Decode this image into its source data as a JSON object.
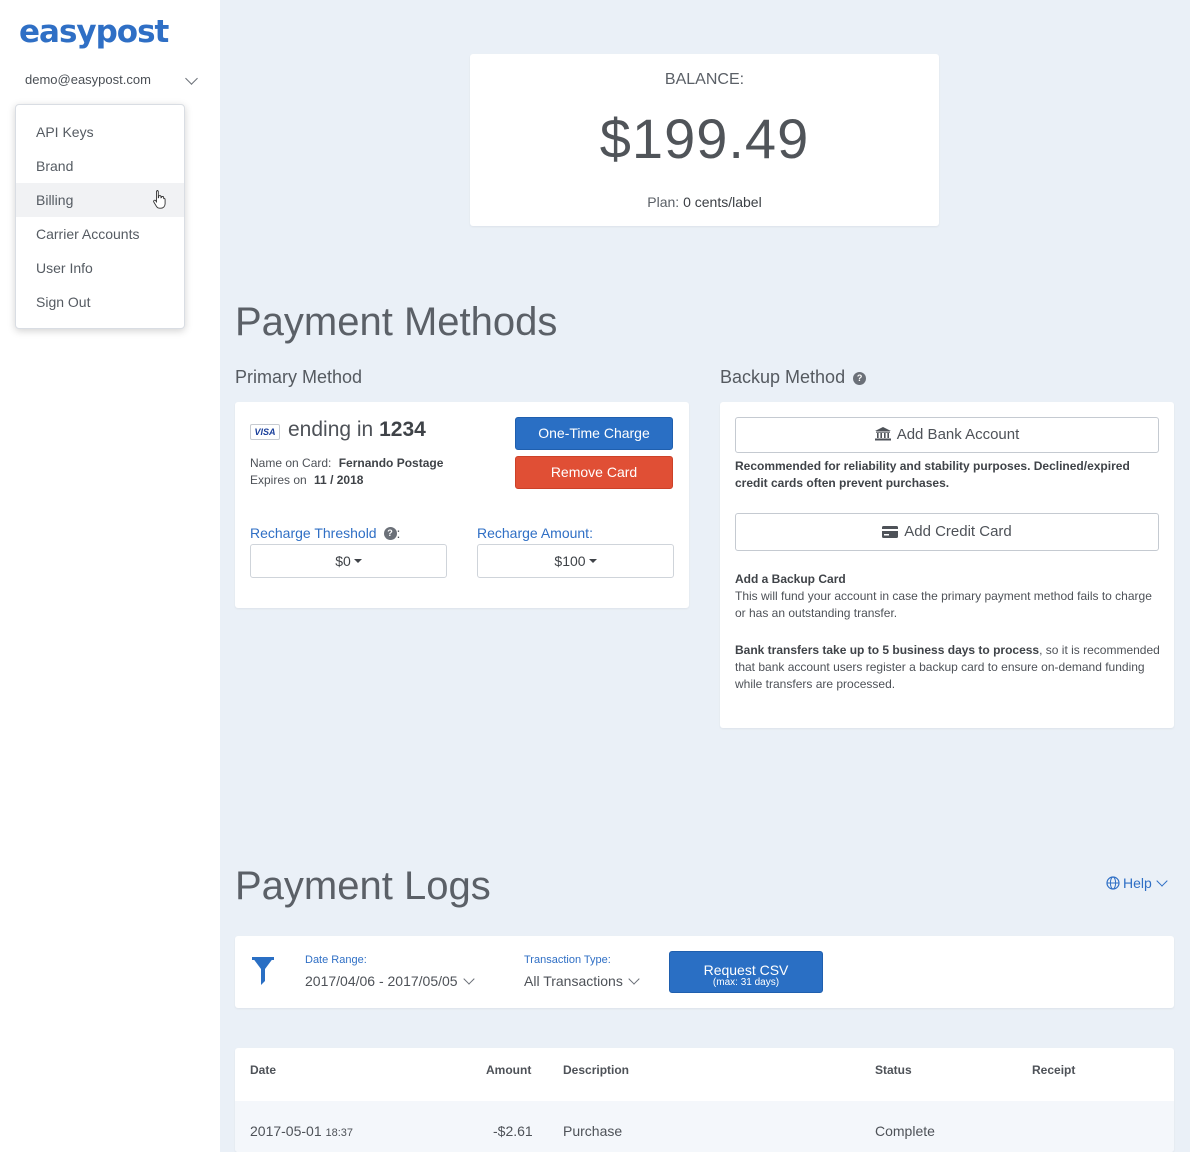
{
  "sidebar": {
    "logo": "easypost",
    "account_email": "demo@easypost.com",
    "menu_items": [
      {
        "label": "API Keys"
      },
      {
        "label": "Brand"
      },
      {
        "label": "Billing"
      },
      {
        "label": "Carrier Accounts"
      },
      {
        "label": "User Info"
      },
      {
        "label": "Sign Out"
      }
    ]
  },
  "balance": {
    "label": "BALANCE:",
    "amount": "$199.49",
    "plan_label": "Plan:",
    "plan_value": "0 cents/label"
  },
  "payment_methods": {
    "title": "Payment Methods",
    "primary": {
      "heading": "Primary Method",
      "card_brand": "VISA",
      "ending_text": "ending in",
      "last4": "1234",
      "name_label": "Name on Card:",
      "name_value": "Fernando Postage",
      "expires_label": "Expires on",
      "expires_value": "11 / 2018",
      "one_time_charge": "One-Time Charge",
      "remove_card": "Remove Card",
      "threshold_label": "Recharge Threshold",
      "threshold_value": "$0",
      "amount_label": "Recharge Amount:",
      "amount_value": "$100"
    },
    "backup": {
      "heading": "Backup Method",
      "add_bank": "Add Bank Account",
      "bank_note": "Recommended for reliability and stability purposes. Declined/expired credit cards often prevent purchases.",
      "add_credit": "Add Credit Card",
      "backup_title": "Add a Backup Card",
      "backup_text": "This will fund your account in case the primary payment method fails to charge or has an outstanding transfer.",
      "transfer_bold": "Bank transfers take up to 5 business days to process",
      "transfer_text": ", so it is recommended that bank account users register a backup card to ensure on-demand funding while transfers are processed."
    }
  },
  "payment_logs": {
    "title": "Payment Logs",
    "help": "Help",
    "date_range_label": "Date Range:",
    "date_range_value": "2017/04/06 - 2017/05/05",
    "txn_type_label": "Transaction Type:",
    "txn_type_value": "All Transactions",
    "csv_label": "Request CSV",
    "csv_sub": "(max: 31 days)",
    "columns": [
      "Date",
      "Amount",
      "Description",
      "Status",
      "Receipt"
    ],
    "rows": [
      {
        "date": "2017-05-01",
        "time": "18:37",
        "amount": "-$2.61",
        "description": "Purchase",
        "status": "Complete"
      }
    ]
  },
  "colors": {
    "accent": "#2a6fc4",
    "danger": "#e04f35",
    "page_bg": "#eaf0f7"
  }
}
